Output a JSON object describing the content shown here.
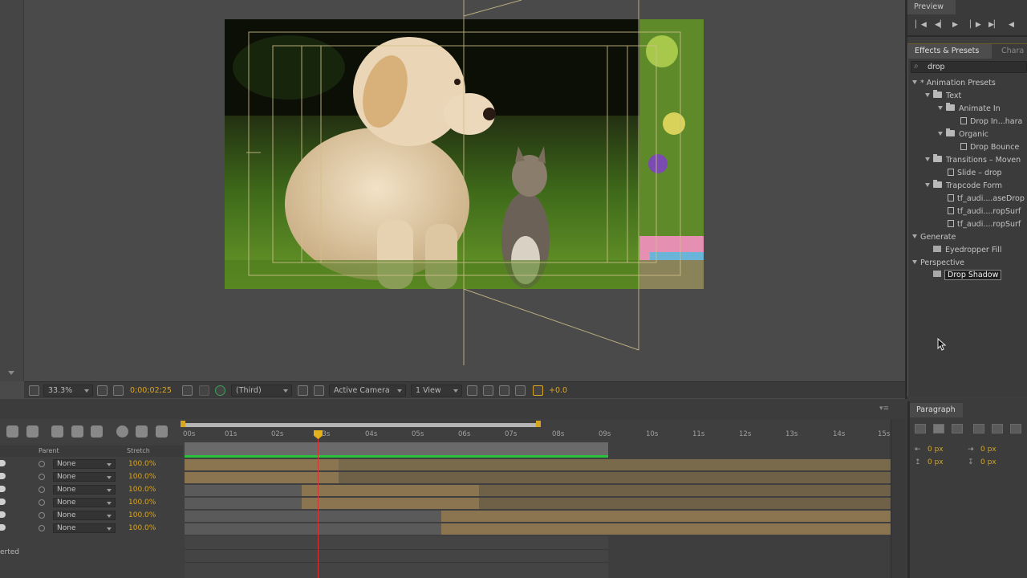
{
  "composition": {
    "zoom": "33.3%",
    "timecode": "0;00;02;25",
    "view_mode": "(Third)",
    "camera": "Active Camera",
    "views": "1 View",
    "exposure": "+0.0"
  },
  "preview": {
    "tab_label": "Preview",
    "controls": [
      "first-frame",
      "prev-frame",
      "play",
      "next-frame",
      "last-frame",
      "audio"
    ]
  },
  "effects": {
    "tab_label": "Effects & Presets",
    "other_tab": "Chara",
    "search_value": "drop",
    "tree": [
      {
        "label": "* Animation Presets",
        "type": "folder",
        "level": 0
      },
      {
        "label": "Text",
        "type": "folder",
        "level": 1
      },
      {
        "label": "Animate In",
        "type": "folder",
        "level": 2
      },
      {
        "label": "Drop In...hara",
        "type": "preset",
        "level": 3
      },
      {
        "label": "Organic",
        "type": "folder",
        "level": 2
      },
      {
        "label": "Drop Bounce",
        "type": "preset",
        "level": 3
      },
      {
        "label": "Transitions – Moven",
        "type": "folder",
        "level": 1
      },
      {
        "label": "Slide – drop",
        "type": "preset",
        "level": 2
      },
      {
        "label": "Trapcode Form",
        "type": "folder",
        "level": 1
      },
      {
        "label": "tf_audi....aseDrop",
        "type": "preset",
        "level": 2
      },
      {
        "label": "tf_audi....ropSurf",
        "type": "preset",
        "level": 2
      },
      {
        "label": "tf_audi....ropSurf",
        "type": "preset",
        "level": 2
      },
      {
        "label": "Generate",
        "type": "category",
        "level": 0
      },
      {
        "label": "Eyedropper Fill",
        "type": "effect",
        "level": 1
      },
      {
        "label": "Perspective",
        "type": "category",
        "level": 0
      },
      {
        "label": "Drop Shadow",
        "type": "effect",
        "level": 1,
        "selected": true
      }
    ]
  },
  "timeline": {
    "header_parent": "Parent",
    "header_stretch": "Stretch",
    "ruler_labels": [
      "00s",
      "01s",
      "02s",
      "03s",
      "04s",
      "05s",
      "06s",
      "07s",
      "08s",
      "09s",
      "10s",
      "11s",
      "12s",
      "13s",
      "14s",
      "15s"
    ],
    "layers": [
      {
        "parent": "None",
        "stretch": "100.0%"
      },
      {
        "parent": "None",
        "stretch": "100.0%"
      },
      {
        "parent": "None",
        "stretch": "100.0%"
      },
      {
        "parent": "None",
        "stretch": "100.0%"
      },
      {
        "parent": "None",
        "stretch": "100.0%"
      },
      {
        "parent": "None",
        "stretch": "100.0%"
      }
    ],
    "footer_text": "erted"
  },
  "paragraph": {
    "tab_label": "Paragraph",
    "indent_left": "0 px",
    "indent_right": "0 px",
    "space_before": "0 px",
    "space_after": "0 px"
  },
  "colors": {
    "accent_yellow": "#d9a520",
    "playhead_red": "#d73535",
    "render_green": "#29c23a",
    "track_tan": "#8a7550"
  }
}
